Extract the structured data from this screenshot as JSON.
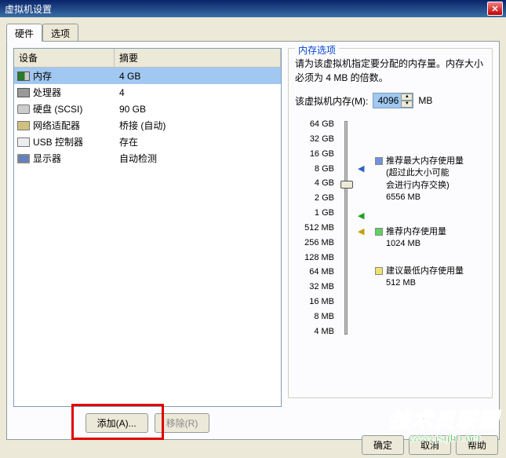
{
  "window": {
    "title": "虚拟机设置"
  },
  "tabs": {
    "hardware": "硬件",
    "options": "选项"
  },
  "device_table": {
    "header_device": "设备",
    "header_summary": "摘要",
    "rows": [
      {
        "icon": "memory-icon",
        "name": "内存",
        "summary": "4 GB"
      },
      {
        "icon": "cpu-icon",
        "name": "处理器",
        "summary": "4"
      },
      {
        "icon": "disk-icon",
        "name": "硬盘 (SCSI)",
        "summary": "90 GB"
      },
      {
        "icon": "net-icon",
        "name": "网络适配器",
        "summary": "桥接 (自动)"
      },
      {
        "icon": "usb-icon",
        "name": "USB 控制器",
        "summary": "存在"
      },
      {
        "icon": "display-icon",
        "name": "显示器",
        "summary": "自动检测"
      }
    ]
  },
  "buttons": {
    "add": "添加(A)...",
    "remove": "移除(R)"
  },
  "memory_panel": {
    "group_title": "内存选项",
    "description": "请为该虚拟机指定要分配的内存量。内存大小必须为 4 MB 的倍数。",
    "field_label": "该虚拟机内存(M):",
    "value": "4096",
    "unit": "MB",
    "ticks": [
      "64 GB",
      "32 GB",
      "16 GB",
      "8 GB",
      "4 GB",
      "2 GB",
      "1 GB",
      "512 MB",
      "256 MB",
      "128 MB",
      "64 MB",
      "32 MB",
      "16 MB",
      "8 MB",
      "4 MB"
    ],
    "legend": {
      "max": {
        "label": "推荐最大内存使用量",
        "note1": "(超过此大小可能",
        "note2": "会进行内存交换)",
        "value": "6556 MB"
      },
      "rec": {
        "label": "推荐内存使用量",
        "value": "1024 MB"
      },
      "min": {
        "label": "建议最低内存使用量",
        "value": "512 MB"
      }
    }
  },
  "footer": {
    "ok": "确定",
    "cancel": "取消",
    "help": "帮助"
  },
  "watermark": {
    "text": "技术员联盟",
    "url": "www.jsgho.net"
  }
}
